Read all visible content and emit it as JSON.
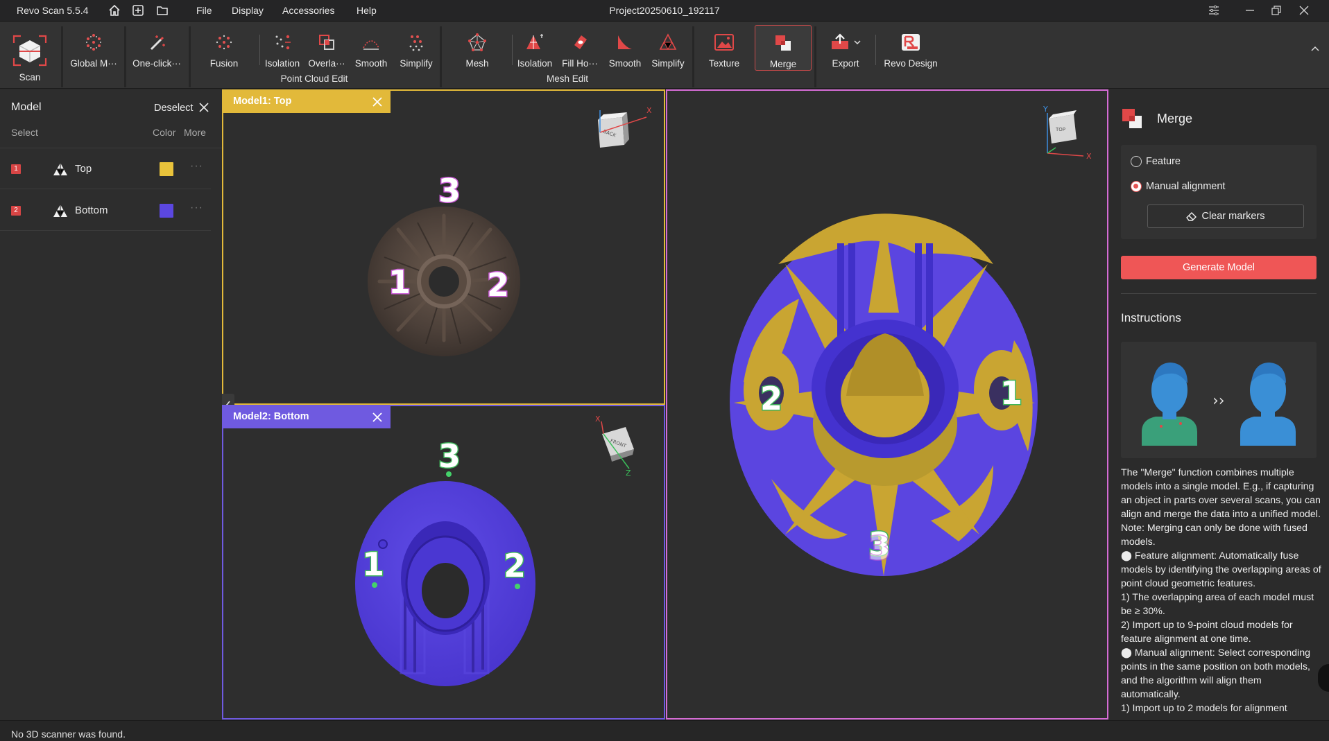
{
  "app": {
    "name": "Revo Scan 5.5.4",
    "project": "Project20250610_192117",
    "menu": [
      "File",
      "Display",
      "Accessories",
      "Help"
    ]
  },
  "ribbon": {
    "scan": "Scan",
    "global_markers": "Global M···",
    "one_click": "One-click···",
    "fusion": "Fusion",
    "pc_isolation": "Isolation",
    "pc_overlap": "Overla···",
    "pc_smooth": "Smooth",
    "pc_simplify": "Simplify",
    "point_cloud_edit": "Point Cloud Edit",
    "mesh": "Mesh",
    "mesh_isolation": "Isolation",
    "fill_holes": "Fill Ho···",
    "mesh_smooth": "Smooth",
    "mesh_simplify": "Simplify",
    "mesh_edit": "Mesh Edit",
    "texture": "Texture",
    "merge": "Merge",
    "export": "Export",
    "revo_design": "Revo Design"
  },
  "left_panel": {
    "title": "Model",
    "deselect": "Deselect",
    "select": "Select",
    "color": "Color",
    "more": "More",
    "models": [
      {
        "index": "1",
        "name": "Top",
        "color": "#e9c33b"
      },
      {
        "index": "2",
        "name": "Bottom",
        "color": "#5b47e0"
      }
    ]
  },
  "viewports": {
    "model1_title": "Model1: Top",
    "model2_title": "Model2: Bottom",
    "axis_x": "X",
    "axis_y": "Y",
    "axis_z": "Z",
    "cube_back": "BACK",
    "cube_front": "FRONT",
    "cube_top": "TOP",
    "markers": [
      "1",
      "2",
      "3"
    ]
  },
  "right_panel": {
    "title": "Merge",
    "option_feature": "Feature",
    "option_manual": "Manual alignment",
    "selected_option": "manual",
    "clear_markers": "Clear markers",
    "generate_model": "Generate Model",
    "instructions_title": "Instructions",
    "instructions": [
      "The \"Merge\" function combines multiple models into a single model. E.g., if capturing an object in parts over several scans, you can align and merge the data into a unified model. Note: Merging can only be done with fused models.",
      "⬤ Feature alignment: Automatically fuse models by identifying the overlapping areas of point cloud geometric features.",
      "1) The overlapping area of each model must be ≥ 30%.",
      "2) Import up to 9-point cloud models for feature alignment at one time.",
      "⬤ Manual alignment: Select corresponding points in the same position on both models, and the algorithm will align them automatically.",
      "1) Import up to 2 models for alignment"
    ]
  },
  "status": "No 3D scanner was found.",
  "colors": {
    "accent": "#ef5656",
    "model1": "#e2b93a",
    "model2": "#6f5ae0",
    "merged_border": "#d46cd4"
  }
}
